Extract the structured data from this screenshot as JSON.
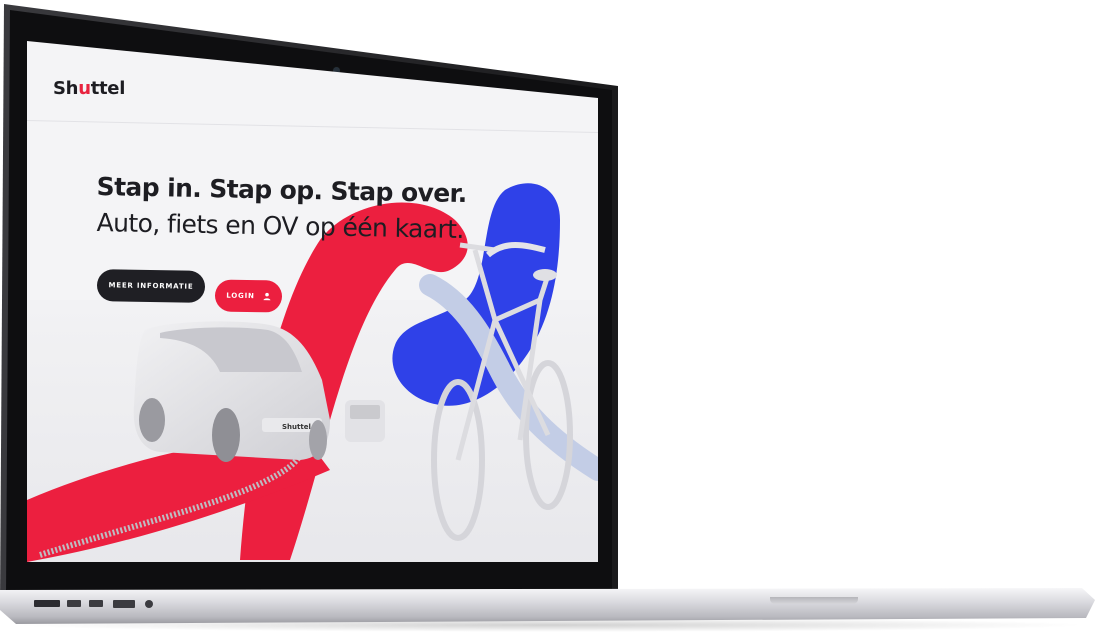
{
  "header": {
    "logo_text_start": "Sh",
    "logo_text_mark": "u",
    "logo_text_end": "ttel"
  },
  "hero": {
    "headline": "Stap in. Stap op. Stap over.",
    "subheadline": "Auto, fiets en OV op één kaart."
  },
  "actions": {
    "info_label": "MEER INFORMATIE",
    "login_label": "LOGIN"
  },
  "car": {
    "plate_text": "Shuttel"
  },
  "colors": {
    "brand_red": "#ec1f3f",
    "brand_blue": "#2f41e8",
    "dark": "#1f1f24"
  },
  "icons": {
    "login": "user-icon",
    "camera": "camera-icon"
  }
}
